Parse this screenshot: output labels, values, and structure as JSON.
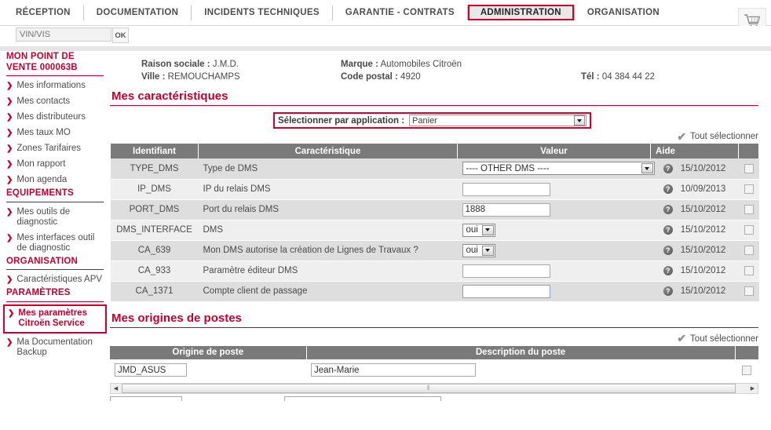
{
  "topnav": {
    "items": [
      {
        "label": "RÉCEPTION",
        "active": false
      },
      {
        "label": "DOCUMENTATION",
        "active": false
      },
      {
        "label": "INCIDENTS TECHNIQUES",
        "active": false
      },
      {
        "label": "GARANTIE - CONTRATS",
        "active": false
      },
      {
        "label": "ADMINISTRATION",
        "active": true
      },
      {
        "label": "ORGANISATION",
        "active": false
      }
    ],
    "cart_icon": "shopping-cart-icon"
  },
  "search": {
    "placeholder": "VIN/VIS",
    "value": "",
    "ok_label": "OK"
  },
  "sidebar": {
    "groups": [
      {
        "title": "MON POINT DE VENTE 000063B",
        "items": [
          {
            "label": "Mes informations"
          },
          {
            "label": "Mes contacts"
          },
          {
            "label": "Mes distributeurs"
          },
          {
            "label": "Mes taux MO"
          },
          {
            "label": "Zones Tarifaires"
          },
          {
            "label": "Mon rapport"
          },
          {
            "label": "Mon agenda"
          }
        ]
      },
      {
        "title": "EQUIPEMENTS",
        "items": [
          {
            "label": "Mes outils de diagnostic"
          },
          {
            "label": "Mes interfaces outil de diagnostic"
          }
        ]
      },
      {
        "title": "ORGANISATION",
        "items": [
          {
            "label": "Caractéristiques APV"
          }
        ]
      },
      {
        "title": "PARAMÈTRES",
        "items": [
          {
            "label": "Mes paramètres Citroën Service",
            "highlight": true
          },
          {
            "label": "Ma Documentation Backup"
          }
        ]
      }
    ]
  },
  "info": {
    "raison_sociale_label": "Raison sociale :",
    "raison_sociale_value": "J.M.D.",
    "ville_label": "Ville :",
    "ville_value": "REMOUCHAMPS",
    "marque_label": "Marque :",
    "marque_value": "Automobiles Citroën",
    "code_postal_label": "Code postal :",
    "code_postal_value": "4920",
    "tel_label": "Tél :",
    "tel_value": "04 384 44 22"
  },
  "caracteristiques": {
    "title": "Mes caractéristiques",
    "app_select_label": "Sélectionner par application :",
    "app_select_value": "Panier",
    "select_all_label": "Tout sélectionner",
    "columns": [
      "Identifiant",
      "Caractéristique",
      "Valeur",
      "Aide",
      ""
    ],
    "rows": [
      {
        "identifiant": "TYPE_DMS",
        "caracteristique": "Type de DMS",
        "control": "select",
        "value": "---- OTHER DMS ----",
        "control_width": "wide",
        "date": "15/10/2012",
        "checked": false
      },
      {
        "identifiant": "IP_DMS",
        "caracteristique": "IP du relais DMS",
        "control": "text",
        "value": "",
        "date": "10/09/2013",
        "checked": false
      },
      {
        "identifiant": "PORT_DMS",
        "caracteristique": "Port du relais DMS",
        "control": "text",
        "value": "1888",
        "date": "15/10/2012",
        "checked": false
      },
      {
        "identifiant": "DMS_INTERFACE",
        "caracteristique": "DMS",
        "control": "select",
        "value": "oui",
        "control_width": "small",
        "date": "15/10/2012",
        "checked": false
      },
      {
        "identifiant": "CA_639",
        "caracteristique": "Mon DMS autorise la création de Lignes de Travaux ?",
        "control": "select",
        "value": "oui",
        "control_width": "small",
        "date": "15/10/2012",
        "checked": false
      },
      {
        "identifiant": "CA_933",
        "caracteristique": "Paramètre éditeur DMS",
        "control": "text",
        "value": "",
        "date": "15/10/2012",
        "checked": false
      },
      {
        "identifiant": "CA_1371",
        "caracteristique": "Compte client de passage",
        "control": "text",
        "value": "",
        "focused": true,
        "date": "15/10/2012",
        "checked": false
      }
    ]
  },
  "origines": {
    "title": "Mes origines de postes",
    "select_all_label": "Tout sélectionner",
    "columns": [
      "Origine de poste",
      "Description du poste",
      ""
    ],
    "rows": [
      {
        "origine": "JMD_ASUS",
        "description": "Jean-Marie",
        "checked": false
      }
    ],
    "scrollbar": {
      "left_arrow": "◀",
      "right_arrow": "▶",
      "grip": "⦀"
    }
  },
  "colors": {
    "brand_red": "#c3002f",
    "highlight_red": "#d40029",
    "header_gray": "#7a7a7a",
    "row_odd": "#dedede",
    "row_even": "#efefef"
  }
}
